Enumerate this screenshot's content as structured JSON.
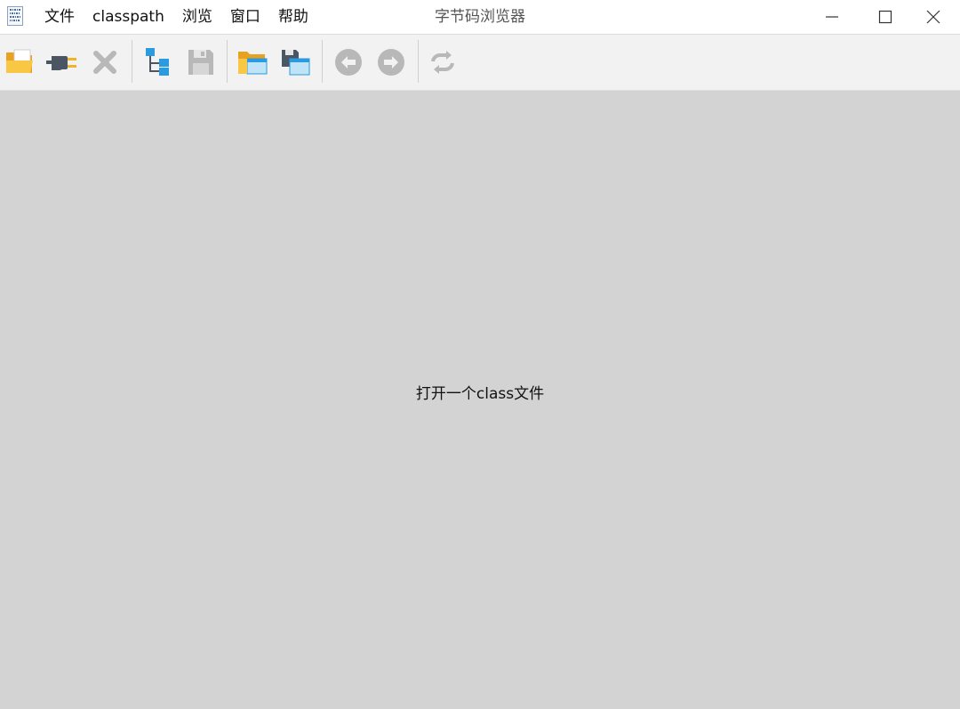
{
  "window": {
    "title": "字节码浏览器",
    "app_icon": "binary-file-icon",
    "controls": [
      "minimize-icon",
      "maximize-icon",
      "close-icon"
    ]
  },
  "menu": {
    "items": [
      {
        "label": "文件"
      },
      {
        "label": "classpath"
      },
      {
        "label": "浏览"
      },
      {
        "label": "窗口"
      },
      {
        "label": "帮助"
      }
    ]
  },
  "toolbar": {
    "buttons": [
      {
        "icon": "open-folder-icon",
        "enabled": true
      },
      {
        "icon": "plug-icon",
        "enabled": true
      },
      {
        "icon": "close-x-icon",
        "enabled": false
      },
      {
        "icon": "hierarchy-icon",
        "enabled": true
      },
      {
        "icon": "save-icon",
        "enabled": false
      },
      {
        "icon": "open-window-folder-icon",
        "enabled": true
      },
      {
        "icon": "save-window-icon",
        "enabled": true
      },
      {
        "icon": "back-arrow-icon",
        "enabled": false
      },
      {
        "icon": "forward-arrow-icon",
        "enabled": false
      },
      {
        "icon": "refresh-icon",
        "enabled": false
      }
    ]
  },
  "main": {
    "placeholder": "打开一个class文件"
  },
  "colors": {
    "content_bg": "#d3d3d3",
    "toolbar_bg": "#f2f2f2",
    "folder_yellow": "#f4b934",
    "accent_blue": "#2a9be0",
    "disabled_gray": "#b8b8b8"
  }
}
